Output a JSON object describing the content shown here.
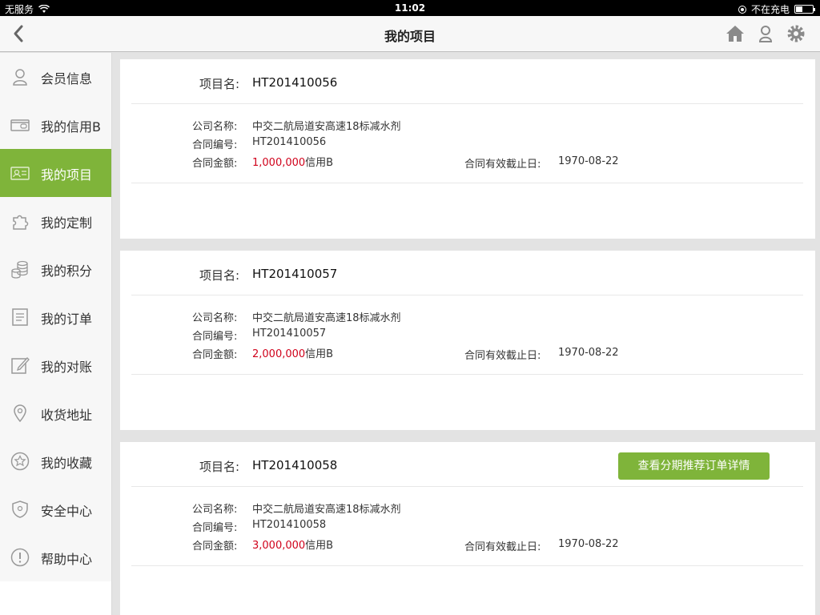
{
  "statusbar": {
    "carrier": "无服务",
    "time": "11:02",
    "charging": "不在充电"
  },
  "navbar": {
    "title": "我的项目"
  },
  "sidebar": {
    "items": [
      {
        "label": "会员信息",
        "icon": "user-icon"
      },
      {
        "label": "我的信用B",
        "icon": "wallet-icon"
      },
      {
        "label": "我的项目",
        "icon": "id-card-icon",
        "active": true
      },
      {
        "label": "我的定制",
        "icon": "puzzle-icon"
      },
      {
        "label": "我的积分",
        "icon": "coins-icon"
      },
      {
        "label": "我的订单",
        "icon": "order-list-icon"
      },
      {
        "label": "我的对账",
        "icon": "edit-icon"
      },
      {
        "label": "收货地址",
        "icon": "location-pin-icon"
      },
      {
        "label": "我的收藏",
        "icon": "star-icon"
      },
      {
        "label": "安全中心",
        "icon": "shield-icon"
      },
      {
        "label": "帮助中心",
        "icon": "info-icon"
      }
    ]
  },
  "labels": {
    "project_name": "项目名:",
    "company": "公司名称:",
    "contract_no": "合同编号:",
    "amount": "合同金额:",
    "expiry": "合同有效截止日:",
    "currency": "信用B"
  },
  "projects": [
    {
      "name": "HT201410056",
      "company": "中交二航局道安高速18标减水剂",
      "contract_no": "HT201410056",
      "amount": "1,000,000",
      "expiry": "1970-08-22"
    },
    {
      "name": "HT201410057",
      "company": "中交二航局道安高速18标减水剂",
      "contract_no": "HT201410057",
      "amount": "2,000,000",
      "expiry": "1970-08-22"
    },
    {
      "name": "HT201410058",
      "company": "中交二航局道安高速18标减水剂",
      "contract_no": "HT201410058",
      "amount": "3,000,000",
      "expiry": "1970-08-22",
      "button": "查看分期推荐订单详情"
    }
  ],
  "colors": {
    "accent": "#7fb43a",
    "amount": "#d0021b"
  }
}
